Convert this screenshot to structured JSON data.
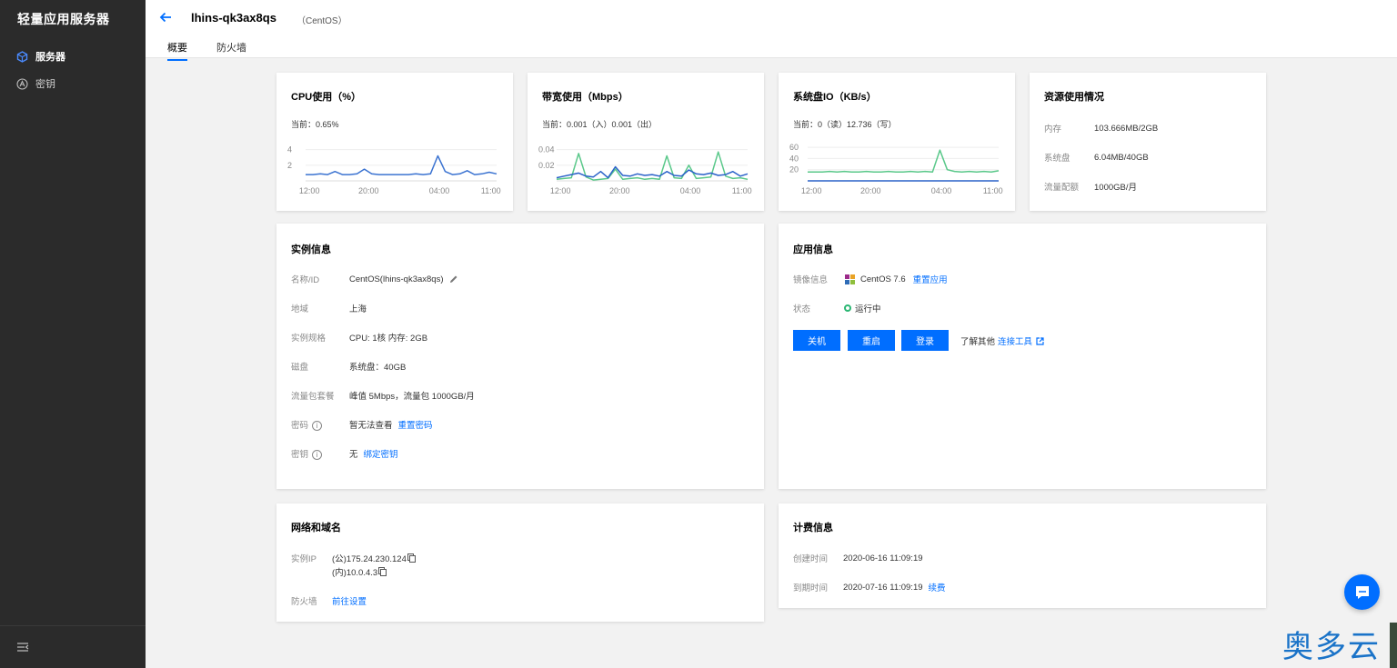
{
  "sidebar": {
    "brand": "轻量应用服务器",
    "items": [
      {
        "label": "服务器",
        "icon": "cube-icon",
        "active": true
      },
      {
        "label": "密钥",
        "icon": "key-icon",
        "active": false
      }
    ]
  },
  "header": {
    "title": "lhins-qk3ax8qs",
    "os": "（CentOS）",
    "tabs": [
      {
        "label": "概要",
        "active": true
      },
      {
        "label": "防火墙",
        "active": false
      }
    ]
  },
  "cpu": {
    "title": "CPU使用（%）",
    "current_label": "当前：",
    "current_value": "0.65%",
    "chart_data": {
      "type": "line",
      "x_ticks": [
        "12:00",
        "20:00",
        "04:00",
        "11:00"
      ],
      "y_ticks": [
        "4",
        "2"
      ],
      "ylim": [
        0,
        5
      ],
      "series": [
        {
          "color": "#3b73d1",
          "values": [
            0.8,
            0.8,
            0.9,
            0.8,
            1.2,
            0.8,
            0.8,
            0.9,
            1.5,
            0.9,
            0.8,
            0.8,
            0.8,
            0.8,
            0.8,
            0.9,
            0.8,
            0.9,
            3.2,
            1.2,
            0.8,
            0.9,
            1.3,
            0.8,
            0.9,
            1.1,
            0.9
          ]
        }
      ]
    }
  },
  "bandwidth": {
    "title": "带宽使用（Mbps）",
    "current_text": "当前：0.001（入）0.001（出）",
    "chart_data": {
      "type": "line",
      "x_ticks": [
        "12:00",
        "20:00",
        "04:00",
        "11:00"
      ],
      "y_ticks": [
        "0.04",
        "0.02"
      ],
      "ylim": [
        0,
        0.05
      ],
      "series": [
        {
          "color": "#5ac88a",
          "values": [
            0.002,
            0.003,
            0.004,
            0.035,
            0.005,
            0.001,
            0.002,
            0.003,
            0.015,
            0.002,
            0.003,
            0.004,
            0.002,
            0.003,
            0.002,
            0.032,
            0.004,
            0.003,
            0.02,
            0.003,
            0.004,
            0.005,
            0.037,
            0.006,
            0.003,
            0.004,
            0.002
          ]
        },
        {
          "color": "#2a62c9",
          "values": [
            0.004,
            0.006,
            0.008,
            0.01,
            0.006,
            0.005,
            0.012,
            0.004,
            0.018,
            0.007,
            0.006,
            0.009,
            0.007,
            0.008,
            0.006,
            0.012,
            0.007,
            0.006,
            0.014,
            0.009,
            0.008,
            0.01,
            0.007,
            0.008,
            0.012,
            0.006,
            0.009
          ]
        }
      ]
    }
  },
  "diskio": {
    "title": "系统盘IO（KB/s）",
    "current_text": "当前：0（读）12.736（写）",
    "chart_data": {
      "type": "line",
      "x_ticks": [
        "12:00",
        "20:00",
        "04:00",
        "11:00"
      ],
      "y_ticks": [
        "60",
        "40",
        "20"
      ],
      "ylim": [
        0,
        70
      ],
      "series": [
        {
          "color": "#5ac88a",
          "values": [
            16,
            16,
            16,
            17,
            16,
            17,
            16,
            16,
            17,
            16,
            16,
            17,
            16,
            16,
            17,
            16,
            17,
            16,
            55,
            20,
            17,
            16,
            17,
            16,
            17,
            16,
            18
          ]
        },
        {
          "color": "#2a62c9",
          "values": [
            0,
            0,
            0,
            0,
            0,
            0,
            0,
            0,
            0,
            0,
            0,
            0,
            0,
            0,
            0,
            0,
            0,
            0,
            0,
            0,
            0,
            0,
            0,
            0,
            0,
            0,
            0
          ]
        }
      ]
    }
  },
  "resources": {
    "title": "资源使用情况",
    "rows": [
      {
        "key": "内存",
        "value": "103.666MB/2GB"
      },
      {
        "key": "系统盘",
        "value": "6.04MB/40GB"
      },
      {
        "key": "流量配额",
        "value": "1000GB/月"
      }
    ]
  },
  "instance": {
    "title": "实例信息",
    "rows": [
      {
        "key": "名称/ID",
        "value": "CentOS(lhins-qk3ax8qs)"
      },
      {
        "key": "地域",
        "value": "上海"
      },
      {
        "key": "实例规格",
        "value": "CPU: 1核 内存: 2GB"
      },
      {
        "key": "磁盘",
        "value": "系统盘：40GB"
      },
      {
        "key": "流量包套餐",
        "value": "峰值 5Mbps，流量包 1000GB/月"
      },
      {
        "key": "密码",
        "value": "暂无法查看",
        "link": "重置密码"
      },
      {
        "key": "密钥",
        "value": "无",
        "link": "绑定密钥"
      }
    ]
  },
  "app": {
    "title": "应用信息",
    "image_key": "镜像信息",
    "image_value": "CentOS 7.6",
    "image_link": "重置应用",
    "status_key": "状态",
    "status_value": "运行中",
    "buttons": [
      "关机",
      "重启",
      "登录"
    ],
    "tools_text": "了解其他",
    "tools_link": "连接工具"
  },
  "network": {
    "title": "网络和域名",
    "ip_key": "实例IP",
    "ip_public": "(公)175.24.230.124",
    "ip_private": "(内)10.0.4.3",
    "fw_key": "防火墙",
    "fw_link": "前往设置"
  },
  "billing": {
    "title": "计费信息",
    "created_key": "创建时间",
    "created_value": "2020-06-16 11:09:19",
    "expire_key": "到期时间",
    "expire_value": "2020-07-16 11:09:19",
    "renew_link": "续费"
  },
  "watermark": "奥多云",
  "colors": {
    "accent": "#006eff",
    "sidebar": "#2b2b2b",
    "green": "#5ac88a",
    "blue": "#2a62c9"
  }
}
